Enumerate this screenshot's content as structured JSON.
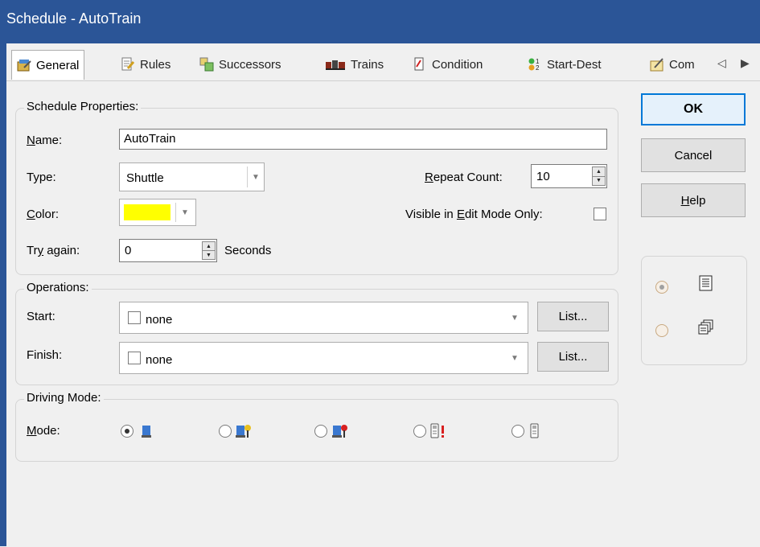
{
  "window": {
    "title": "Schedule - AutoTrain"
  },
  "tabs": [
    {
      "label": "General",
      "icon": "general-icon",
      "active": true
    },
    {
      "label": "Rules",
      "icon": "rules-icon"
    },
    {
      "label": "Successors",
      "icon": "successors-icon"
    },
    {
      "label": "Trains",
      "icon": "trains-icon"
    },
    {
      "label": "Condition",
      "icon": "condition-icon"
    },
    {
      "label": "Start-Dest",
      "icon": "start-dest-icon"
    },
    {
      "label": "Com",
      "icon": "commands-icon"
    }
  ],
  "tab_nav": {
    "prev": "◁",
    "next": "▶"
  },
  "schedule_properties": {
    "group_label": "Schedule Properties:",
    "name_label": "Name:",
    "name_value": "AutoTrain",
    "type_label": "Type:",
    "type_value": "Shuttle",
    "repeat_label": "Repeat Count:",
    "repeat_value": "10",
    "color_label": "Color:",
    "color_value": "#ffff00",
    "visible_label": "Visible in Edit Mode Only:",
    "visible_checked": false,
    "try_again_label": "Try again:",
    "try_again_value": "0",
    "seconds_label": "Seconds"
  },
  "operations": {
    "group_label": "Operations:",
    "start_label": "Start:",
    "start_value": "none",
    "finish_label": "Finish:",
    "finish_value": "none",
    "list_label": "List..."
  },
  "driving_mode": {
    "group_label": "Driving Mode:",
    "mode_label": "Mode:",
    "options": [
      {
        "icon": "blue-train-icon",
        "selected": true
      },
      {
        "icon": "blue-train-yellow-signal-icon",
        "selected": false
      },
      {
        "icon": "blue-train-red-signal-icon",
        "selected": false
      },
      {
        "icon": "handheld-red-alert-icon",
        "selected": false
      },
      {
        "icon": "handheld-icon",
        "selected": false
      }
    ]
  },
  "buttons": {
    "ok": "OK",
    "cancel": "Cancel",
    "help": "Help"
  },
  "side_options": [
    {
      "icon": "list-view-icon",
      "selected": true
    },
    {
      "icon": "multi-window-icon",
      "selected": false
    }
  ],
  "colors": {
    "titlebar": "#2b5597",
    "ok_border": "#0078d7"
  }
}
